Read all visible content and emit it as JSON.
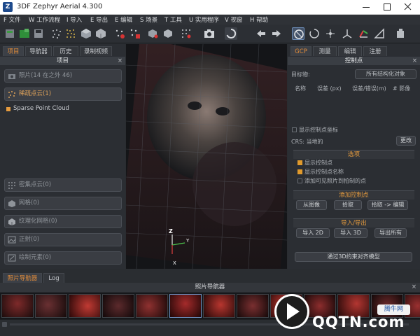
{
  "window": {
    "app_icon": "Z",
    "title": "3DF Zephyr Aerial 4.300",
    "minimize_icon": "minimize-icon",
    "maximize_icon": "maximize-icon",
    "close_icon": "close-icon"
  },
  "menu": [
    {
      "label": "F 文件"
    },
    {
      "label": "W 工作流程"
    },
    {
      "label": "I 导入"
    },
    {
      "label": "E 导出"
    },
    {
      "label": "E 编辑"
    },
    {
      "label": "S 场景"
    },
    {
      "label": "T 工具"
    },
    {
      "label": "U 实用程序"
    },
    {
      "label": "V 视窗"
    },
    {
      "label": "H 帮助"
    }
  ],
  "left_panel": {
    "tabs": [
      "项目",
      "导航器",
      "历史",
      "录制视频"
    ],
    "active_tab": 0,
    "header": "项目",
    "groups_top": [
      {
        "label": "照片(14 在之外 46)",
        "icon": "photo-icon",
        "active": false
      },
      {
        "label": "稀疏点云(1)",
        "icon": "sparse-cloud-icon",
        "active": true
      }
    ],
    "tree_item": "Sparse Point Cloud",
    "groups_bottom": [
      {
        "label": "密集点云(0)",
        "icon": "dense-cloud-icon"
      },
      {
        "label": "网格(0)",
        "icon": "mesh-icon"
      },
      {
        "label": "纹理化网格(0)",
        "icon": "textured-mesh-icon"
      },
      {
        "label": "正射(0)",
        "icon": "ortho-icon"
      },
      {
        "label": "绘制元素(0)",
        "icon": "drawing-icon"
      }
    ]
  },
  "viewport": {
    "axis_z": "Z",
    "axis_y": "Y",
    "axis_x": "X"
  },
  "right_panel": {
    "tabs": [
      "GCP",
      "测量",
      "编辑",
      "注册"
    ],
    "active_tab": 0,
    "header": "控制点",
    "target_label": "目标物:",
    "target_value": "所有结构化对象",
    "table_headers": [
      "名称",
      "误差 (px)",
      "误差/错误(m)",
      "# 影像"
    ],
    "show_coords": "显示控制点坐标",
    "crs_label": "CRS: 当地的",
    "crs_button": "更改",
    "options_title": "选项",
    "options": [
      {
        "label": "显示控制点",
        "checked": true
      },
      {
        "label": "显示控制点名称",
        "checked": true
      },
      {
        "label": "添加可见照片到拍制的点",
        "checked": false
      }
    ],
    "add_title": "添加控制点",
    "add_buttons": [
      "从图像",
      "拾取",
      "拾取 -> 编辑"
    ],
    "io_title": "导入/导出",
    "io_buttons": [
      "导入 2D",
      "导入 3D",
      "导出所有"
    ],
    "bottom_button": "通过3D约束对齐模型"
  },
  "bottom": {
    "tabs": [
      "照片导航器",
      "Log"
    ],
    "active_tab": 0,
    "navigator_title": "照片导航器"
  },
  "watermark": {
    "text": "QQTN.com",
    "badge": "腾牛网"
  },
  "colors": {
    "accent": "#e59b3e",
    "panel": "#2b2e33",
    "viewport": "#121316"
  }
}
